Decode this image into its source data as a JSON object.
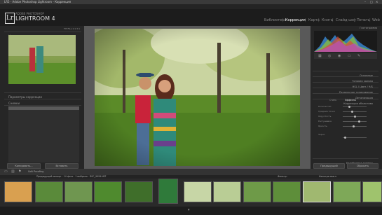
{
  "window": {
    "title": "LR5 - Adobe Photoshop Lightroom - Коррекция"
  },
  "menu": [
    "Файл",
    "Правка",
    "Коррекция",
    "Фото",
    "Установки",
    "Инструменты",
    "Вид",
    "Окно",
    "Справка"
  ],
  "identity": {
    "brand_small": "ADOBE PHOTOSHOP",
    "brand": "LIGHTROOM 4"
  },
  "modules": [
    "Библиотека",
    "Коррекция",
    "Карта",
    "Книга",
    "Слайд-шоу",
    "Печать",
    "Web"
  ],
  "left_panel": {
    "navigator_label": "Навигатор",
    "navigator_zoom": "FIT  FILL  1:1  3:1",
    "presets_label": "Параметры коррекции",
    "snapshots_label": "Снимки",
    "history_label": "История",
    "history_items": [
      "Эффект: Виньетирование",
      "Эффект: виньетирование",
      "Эффект: виньетирование",
      "Эффект: виньетирование",
      "Эффект: виньетирование",
      "Эффект: виньетирование",
      "Эффект: виньетирование",
      "Настройка тонов",
      "Настройка тонов",
      "Настройка тонов",
      "Эффект: виньетирование",
      "Эффект: виньетирование",
      "Эффект: виньетирование",
      "Эффект: виньетирование",
      "Эффект: виньетирование",
      "Эффект: виньетирование"
    ],
    "copy_button": "Копировать...",
    "paste_button": "Вставить"
  },
  "right_panel": {
    "histogram_label": "Гистограмма",
    "sections": [
      "Основные",
      "Тоновая кривая",
      "HSL / Цвет / Ч/Б",
      "Раздельное тонирование",
      "Детализация",
      "Коррекция объектива",
      "Эффекты"
    ],
    "effects_tabs": [
      "Стиль",
      "Эффекты"
    ],
    "sliders": [
      "Количество",
      "Средние точки",
      "Округлость",
      "Растушевка",
      "Яркость"
    ],
    "grain_label": "Зерно",
    "camera_label": "Калибровка камеры",
    "prev_button": "Предыдущий",
    "reset_button": "Сбросить"
  },
  "toolbar": {
    "softproof": "Soft Proofing"
  },
  "filmstrip": {
    "info": "Предыдущий импорт · 14 фото · 1 выбрано · DSC_9999.NEF",
    "filter": "Фильтр:",
    "filter_value": "Фильтры выкл."
  }
}
